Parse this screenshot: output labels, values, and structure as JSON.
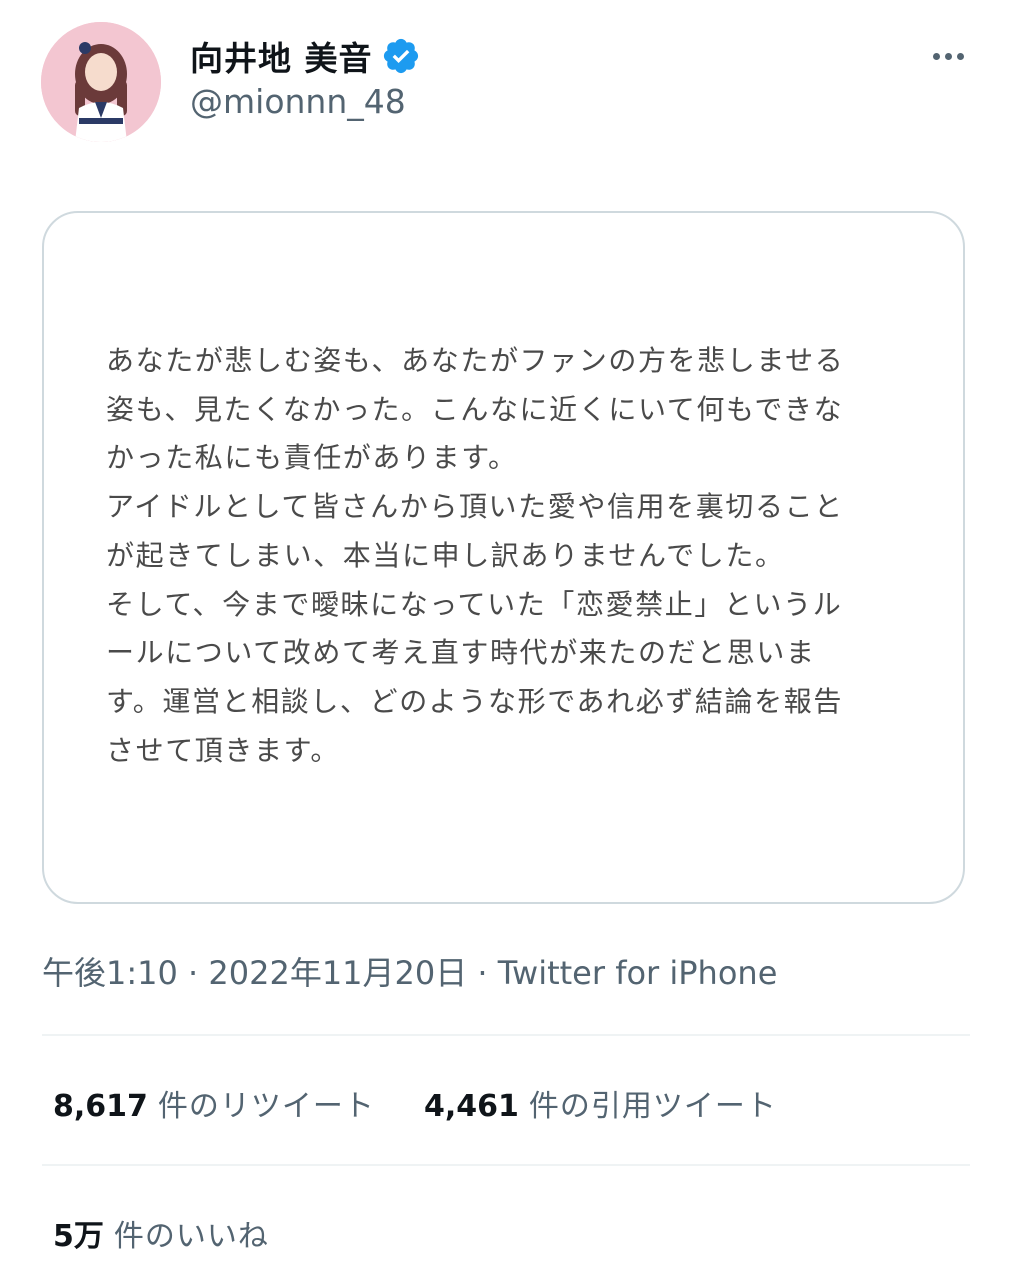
{
  "profile": {
    "display_name": "向井地 美音",
    "handle": "@mionnn_48",
    "verified": true,
    "avatar_icon": "profile-photo"
  },
  "menu": {
    "more_icon": "more-horizontal-icon"
  },
  "tweet": {
    "image_text_lines": [
      "あなたが悲しむ姿も、あなたがファンの方を悲しませる",
      "姿も、見たくなかった。こんなに近くにいて何もできな",
      "かった私にも責任があります。",
      "アイドルとして皆さんから頂いた愛や信用を裏切ること",
      "が起きてしまい、本当に申し訳ありませんでした。",
      "そして、今まで曖昧になっていた「恋愛禁止」というル",
      "ールについて改めて考え直す時代が来たのだと思いま",
      "す。運営と相談し、どのような形であれ必ず結論を報告",
      "させて頂きます。"
    ],
    "meta": "午後1:10 · 2022年11月20日 · Twitter for iPhone"
  },
  "stats": {
    "retweets": {
      "count": "8,617",
      "label": "件のリツイート"
    },
    "quotes": {
      "count": "4,461",
      "label": "件の引用ツイート"
    },
    "likes": {
      "count": "5万",
      "label": "件のいいね"
    }
  },
  "colors": {
    "verified_blue": "#1d9bf0",
    "secondary_text": "#536471",
    "border": "#cfd9de",
    "divider": "#eff3f4"
  }
}
